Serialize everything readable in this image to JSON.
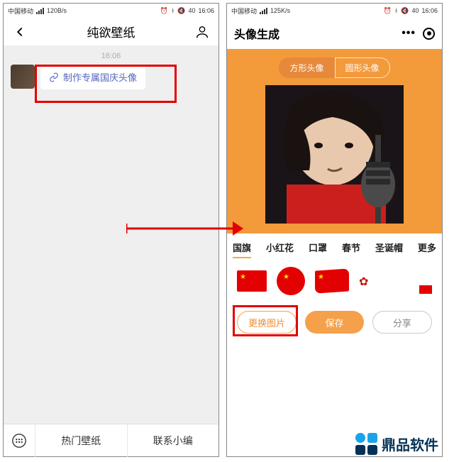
{
  "status": {
    "carrier": "中国移动",
    "speed1": "120B/s",
    "speed2": "125K/s",
    "battery": "40",
    "time": "16:06"
  },
  "left": {
    "title": "纯欲壁纸",
    "timestamp": "16:06",
    "link_text": "制作专属国庆头像",
    "footer": {
      "tab1": "热门壁纸",
      "tab2": "联系小编"
    }
  },
  "right": {
    "title": "头像生成",
    "shape_tabs": {
      "square": "方形头像",
      "circle": "圆形头像"
    },
    "categories": [
      "国旗",
      "小红花",
      "口罩",
      "春节",
      "圣诞帽",
      "更多"
    ],
    "buttons": {
      "change": "更换图片",
      "save": "保存",
      "share": "分享"
    }
  },
  "brand": "鼎品软件"
}
